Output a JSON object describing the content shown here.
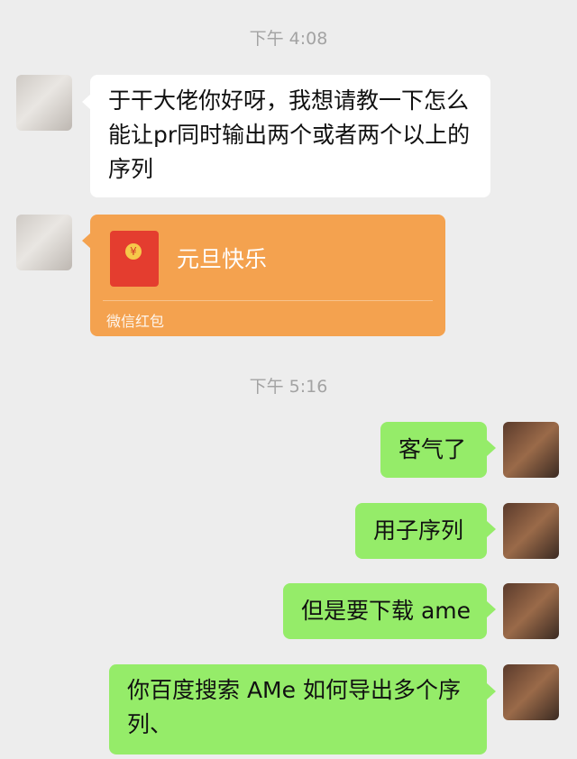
{
  "timestamps": [
    "下午 4:08",
    "下午 5:16"
  ],
  "messages": {
    "m1": "于干大佬你好呀，我想请教一下怎么能让pr同时输出两个或者两个以上的序列",
    "red_packet": {
      "title": "元旦快乐",
      "label": "微信红包",
      "coin_symbol": "¥"
    },
    "m2": "客气了",
    "m3": "用子序列",
    "m4": "但是要下载 ame",
    "m5": "你百度搜索 AMe 如何导出多个序列、"
  },
  "colors": {
    "background": "#ededed",
    "incoming_bubble": "#ffffff",
    "outgoing_bubble": "#95ec69",
    "red_packet": "#f4a24f",
    "timestamp": "#a3a3a3"
  }
}
